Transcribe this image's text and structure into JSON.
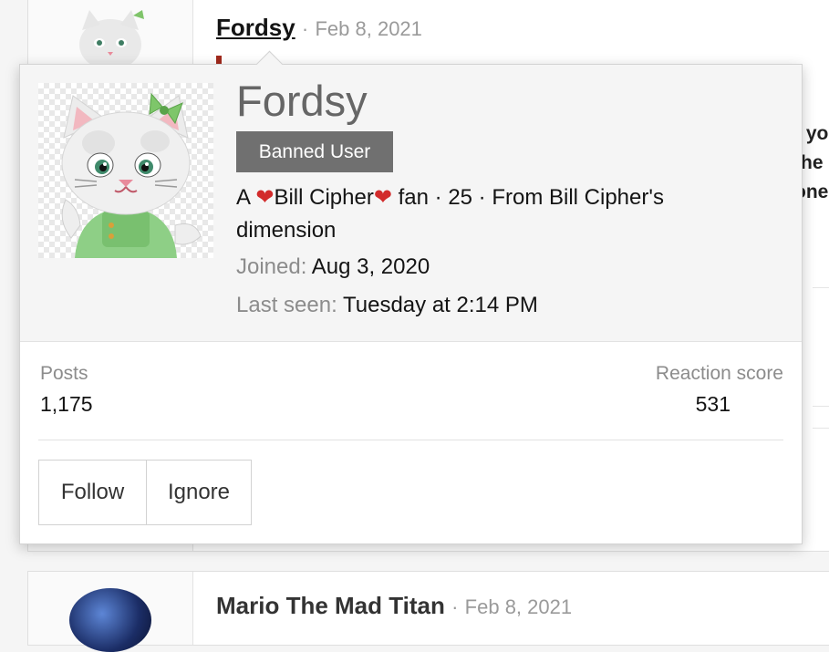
{
  "background_posts": [
    {
      "username": "Fordsy",
      "separator": "·",
      "date": "Feb 8, 2021",
      "snippet_lines": [
        "t yo",
        "the",
        "one"
      ]
    },
    {
      "username": "Mario The Mad Titan",
      "separator": "·",
      "date": "Feb 8, 2021"
    }
  ],
  "hover_card": {
    "name": "Fordsy",
    "banner": "Banned User",
    "blurb": {
      "prefix": "A ",
      "heart": "❤",
      "middle": "Bill Cipher",
      "suffix": " fan · 25 · From Bill Cipher's dimension"
    },
    "joined": {
      "label": "Joined:",
      "value": "Aug 3, 2020"
    },
    "last_seen": {
      "label": "Last seen:",
      "value": "Tuesday at 2:14 PM"
    },
    "posts": {
      "label": "Posts",
      "value": "1,175"
    },
    "reaction_score": {
      "label": "Reaction score",
      "value": "531"
    },
    "buttons": {
      "follow": "Follow",
      "ignore": "Ignore"
    }
  },
  "colors": {
    "banned_badge": "#707070",
    "heart": "#d22b2b",
    "card_header_bg": "#f5f5f5"
  },
  "icons": {
    "avatar": "kitty-cat-avatar"
  }
}
